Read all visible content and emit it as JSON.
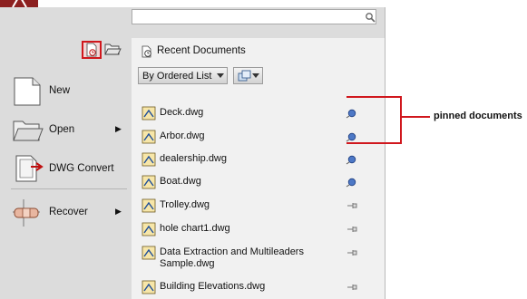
{
  "search": {
    "placeholder": ""
  },
  "left_menu": {
    "items": [
      {
        "label": "New",
        "has_submenu": false,
        "icon": "new-document-icon"
      },
      {
        "label": "Open",
        "has_submenu": true,
        "icon": "open-folder-icon"
      },
      {
        "label": "DWG Convert",
        "has_submenu": false,
        "icon": "dwg-convert-icon"
      },
      {
        "label": "Recover",
        "has_submenu": true,
        "icon": "recover-icon"
      }
    ]
  },
  "recent": {
    "title": "Recent Documents",
    "sort_label": "By Ordered List",
    "documents": [
      {
        "name": "Deck.dwg",
        "pinned": true
      },
      {
        "name": "Arbor.dwg",
        "pinned": true
      },
      {
        "name": "dealership.dwg",
        "pinned": true
      },
      {
        "name": "Boat.dwg",
        "pinned": true
      },
      {
        "name": "Trolley.dwg",
        "pinned": false
      },
      {
        "name": "hole chart1.dwg",
        "pinned": false
      },
      {
        "name": "Data Extraction and Multileaders Sample.dwg",
        "pinned": false
      },
      {
        "name": "Building Elevations.dwg",
        "pinned": false
      }
    ]
  },
  "annotation": {
    "label": "pinned documents",
    "color": "#d0171d"
  },
  "colors": {
    "app_button": "#8c1f1f",
    "menu_bg": "#dcdcdc",
    "panel_bg": "#f1f1f1",
    "highlight": "#d0171d"
  }
}
